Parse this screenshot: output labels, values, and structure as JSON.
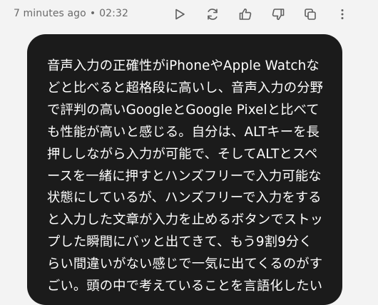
{
  "message": {
    "time_ago": "7 minutes ago",
    "separator": "•",
    "timestamp": "02:32",
    "text": "音声入力の正確性がiPhoneやApple Watchな\nどと比べると超格段に高いし、音声入力の分野\nで評判の高いGoogleとGoogle Pixelと比べて\nも性能が高いと感じる。自分は、ALTキーを長\n押ししながら入力が可能で、そしてALTとスペ\nースを一緒に押すとハンズフリーで入力可能な\n状態にしているが、ハンズフリーで入力をする\nと入力した文章が入力を止めるボタンでストッ\nプした瞬間にバッと出てきて、もう9割9分く\nらい間違いがない感じで一気に出てくるのがす\nごい。頭の中で考えていることを言語化したい"
  },
  "actions": [
    {
      "name": "play-icon"
    },
    {
      "name": "regenerate-icon"
    },
    {
      "name": "thumbs-up-icon"
    },
    {
      "name": "thumbs-down-icon"
    },
    {
      "name": "copy-icon"
    },
    {
      "name": "more-vertical-icon"
    }
  ],
  "colors": {
    "bubble_bg": "#1b1b1b",
    "page_bg": "#f3f3f3",
    "icon": "#5f5f5f",
    "meta_text": "#6a6a6a"
  }
}
